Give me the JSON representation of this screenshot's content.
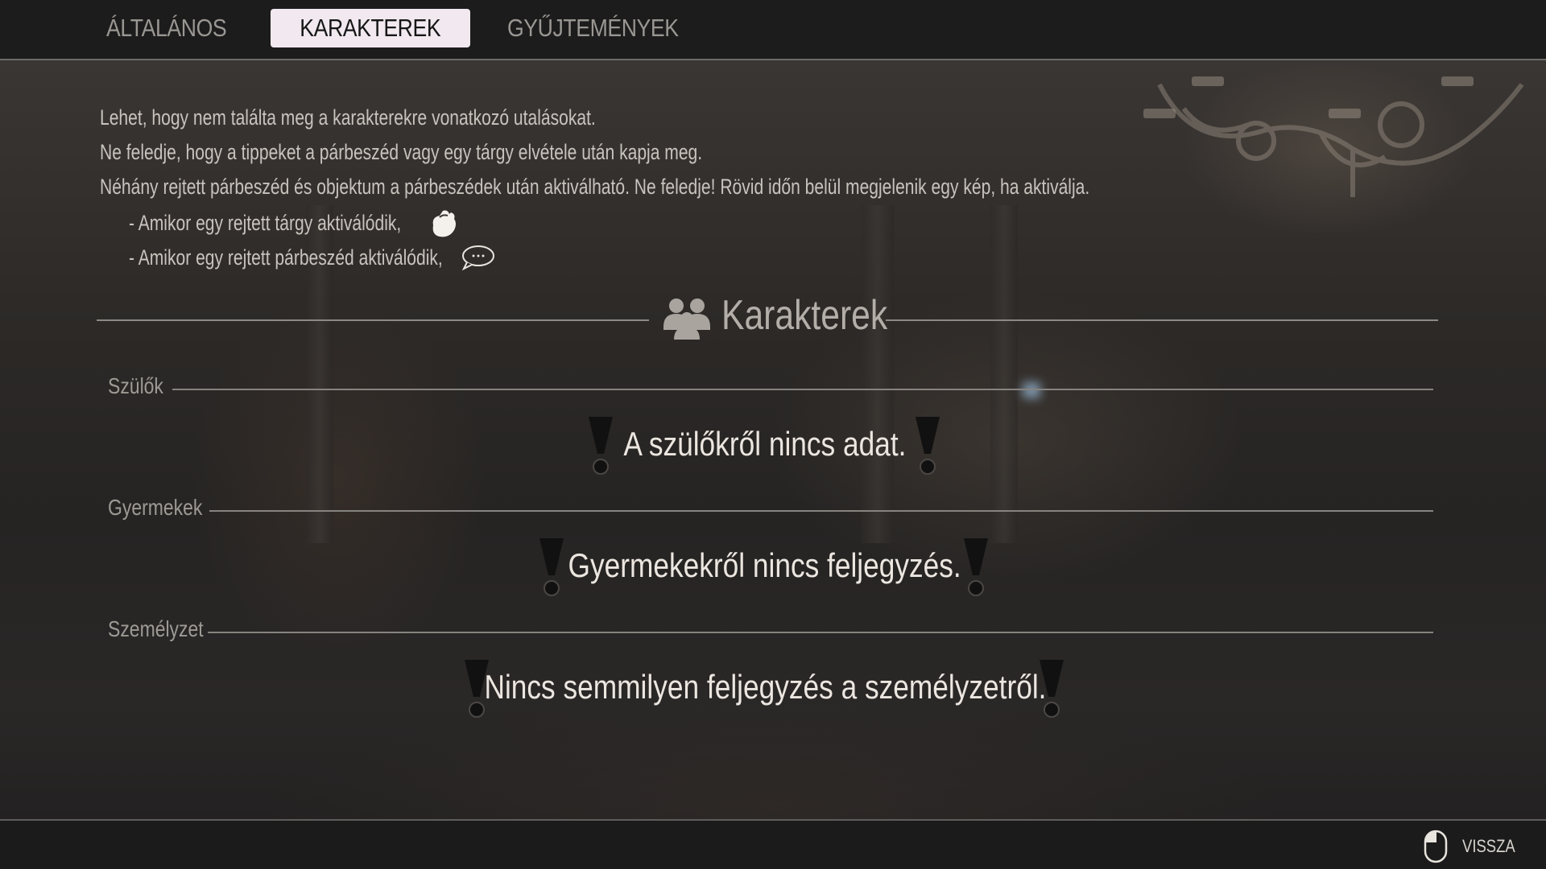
{
  "tabs": [
    {
      "label": "ÁLTALÁNOS",
      "active": false
    },
    {
      "label": "KARAKTEREK",
      "active": true
    },
    {
      "label": "GYŰJTEMÉNYEK",
      "active": false
    }
  ],
  "hints": {
    "line1": "Lehet, hogy nem találta meg a karakterekre vonatkozó utalásokat.",
    "line2": "Ne feledje, hogy a tippeket a párbeszéd vagy egy tárgy elvétele után kapja meg.",
    "line3": "Néhány rejtett párbeszéd és objektum a párbeszédek után aktiválható. Ne feledje! Rövid időn belül megjelenik egy kép, ha aktiválja.",
    "item_hidden_object": "- Amikor egy rejtett tárgy aktiválódik,",
    "item_hidden_dialogue": "- Amikor egy rejtett párbeszéd aktiválódik,"
  },
  "icons": {
    "hidden_object": "hand-grab-icon",
    "hidden_dialogue": "speech-bubble-icon",
    "section": "people-icon",
    "warning": "exclamation-icon",
    "back": "mouse-icon"
  },
  "section": {
    "title": "Karakterek"
  },
  "groups": [
    {
      "label": "Szülők",
      "empty_message": "A szülőkről nincs adat."
    },
    {
      "label": "Gyermekek",
      "empty_message": "Gyermekekről nincs feljegyzés."
    },
    {
      "label": "Személyzet",
      "empty_message": "Nincs semmilyen feljegyzés a személyzetről."
    }
  ],
  "footer": {
    "back_label": "VISSZA"
  },
  "colors": {
    "active_tab_bg": "#f1e9ef",
    "text_primary": "#ece6e0",
    "text_muted": "#9e9a95"
  }
}
